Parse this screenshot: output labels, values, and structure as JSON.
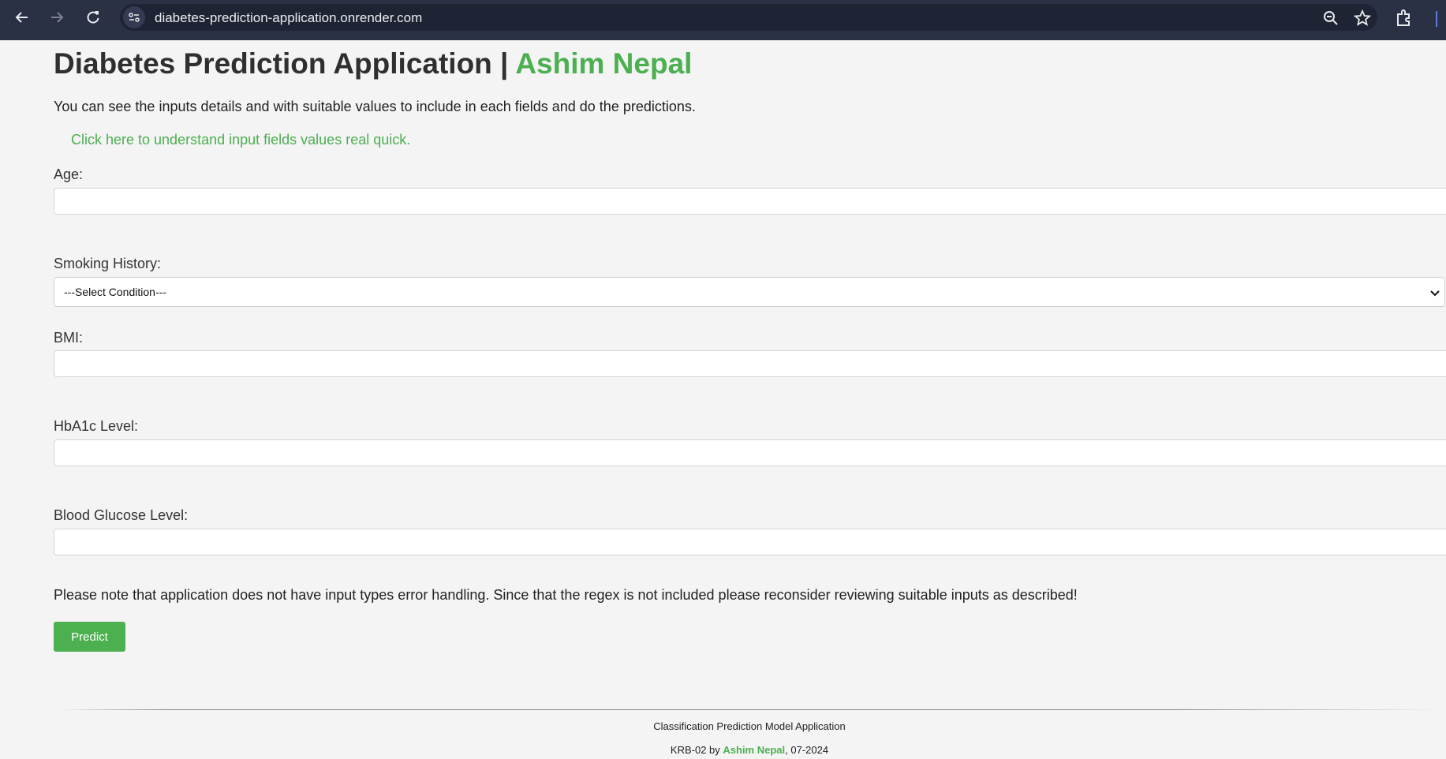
{
  "browser": {
    "url": "diabetes-prediction-application.onrender.com",
    "icons": [
      "back-arrow-icon",
      "forward-arrow-icon",
      "reload-icon",
      "site-info-icon",
      "zoom-icon",
      "bookmark-star-icon",
      "extensions-icon"
    ]
  },
  "header": {
    "title": "Diabetes Prediction Application | ",
    "author": "Ashim Nepal"
  },
  "intro": "You can see the inputs details and with suitable values to include in each fields and do the predictions.",
  "help_link": "Click here to understand input fields values real quick.",
  "form": {
    "age_label": "Age:",
    "age_value": "",
    "smoking_label": "Smoking History:",
    "smoking_selected": "---Select Condition---",
    "bmi_label": "BMI:",
    "bmi_value": "",
    "hba1c_label": "HbA1c Level:",
    "hba1c_value": "",
    "glucose_label": "Blood Glucose Level:",
    "glucose_value": ""
  },
  "note": "Please note that application does not have input types error handling. Since that the regex is not included please reconsider reviewing suitable inputs as described!",
  "predict_label": "Predict",
  "footer": {
    "line1": "Classification Prediction Model Application",
    "line2_prefix": "KRB-02 by ",
    "author": "Ashim Nepal",
    "line2_suffix": ", 07-2024"
  },
  "colors": {
    "accent": "#4caf50",
    "chrome": "#2b3145",
    "page_bg": "#f4f4f4"
  }
}
